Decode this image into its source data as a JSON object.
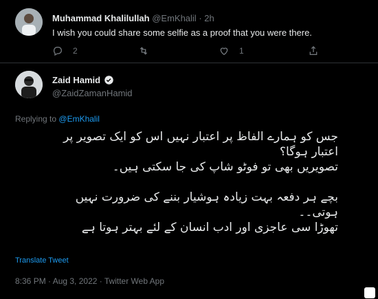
{
  "reply": {
    "author_name": "Muhammad Khalilullah",
    "handle": "@EmKhalil",
    "time_sep": "·",
    "time": "2h",
    "text": "I wish you could share some selfie as a proof that you were there.",
    "reply_count": "2",
    "like_count": "1"
  },
  "tweet": {
    "author_name": "Zaid Hamid",
    "handle": "@ZaidZamanHamid",
    "replying_prefix": "Replying to",
    "replying_to": "@EmKhalil",
    "lines": [
      "جس کو ہمارے الفاظ پر اعتبار نہیں اس کو ایک تصویر پر",
      "اعتبار ہوگا؟",
      "تصویریں بھی تو فوٹو شاپ کی جا سکتی ہیں۔",
      "بچے ہر دفعہ بہت زیادہ ہوشیار بننے کی ضرورت نہیں",
      "ہوتی۔۔",
      "تھوڑا سی عاجزی اور ادب انسان کے لئے بہتر ہوتا ہے"
    ],
    "translate_label": "Translate Tweet",
    "timestamp": "8:36 PM · Aug 3, 2022 · Twitter Web App"
  },
  "colors": {
    "background": "#000000",
    "text": "#e7e9ea",
    "muted": "#71767b",
    "link": "#1d9bf0"
  }
}
